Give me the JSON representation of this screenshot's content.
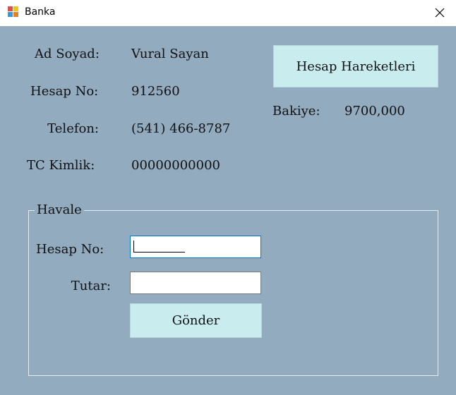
{
  "window": {
    "title": "Banka"
  },
  "account": {
    "name_label": "Ad Soyad:",
    "name_value": "Vural Sayan",
    "account_no_label": "Hesap No:",
    "account_no_value": "912560",
    "phone_label": "Telefon:",
    "phone_value": "(541) 466-8787",
    "tc_label": "TC Kimlik:",
    "tc_value": "00000000000",
    "balance_label": "Bakiye:",
    "balance_value": "9700,000"
  },
  "history_button": {
    "label": "Hesap Hareketleri"
  },
  "transfer": {
    "title": "Havale",
    "account_no_label": "Hesap No:",
    "account_no_value": "",
    "amount_label": "Tutar:",
    "amount_value": "",
    "send_label": "Gönder"
  },
  "colors": {
    "background": "#93abbf",
    "button": "#c9ecef",
    "focus_border": "#0078d7"
  }
}
